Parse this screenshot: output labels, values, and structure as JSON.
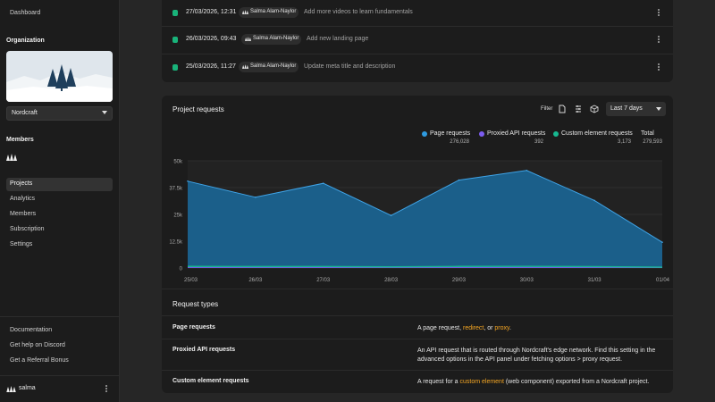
{
  "sidebar": {
    "dashboard": "Dashboard",
    "org_heading": "Organization",
    "org_name": "Nordcraft",
    "members_heading": "Members",
    "nav": [
      {
        "label": "Projects",
        "active": true
      },
      {
        "label": "Analytics",
        "active": false
      },
      {
        "label": "Members",
        "active": false
      },
      {
        "label": "Subscription",
        "active": false
      },
      {
        "label": "Settings",
        "active": false
      }
    ],
    "footer_links": [
      "Documentation",
      "Get help on Discord",
      "Get a Referral Bonus"
    ],
    "user": "salma"
  },
  "activity": [
    {
      "date": "27/03/2026, 12:31",
      "author": "Salma Alam-Naylor",
      "desc": "Add more videos to learn fundamentals"
    },
    {
      "date": "26/03/2026, 09:43",
      "author": "Salma Alam-Naylor",
      "desc": "Add new landing page"
    },
    {
      "date": "25/03/2026, 11:27",
      "author": "Salma Alam-Naylor",
      "desc": "Update meta title and description"
    }
  ],
  "requests": {
    "title": "Project requests",
    "filter_label": "Filter",
    "range": "Last 7 days",
    "legend": [
      {
        "name": "Page requests",
        "value": "276,028",
        "color": "#2f9be0"
      },
      {
        "name": "Proxied API requests",
        "value": "392",
        "color": "#7c5cf0"
      },
      {
        "name": "Custom element requests",
        "value": "3,173",
        "color": "#17b890"
      }
    ],
    "total_label": "Total",
    "total_value": "279,593"
  },
  "chart_data": {
    "type": "area",
    "x": [
      "25/03",
      "26/03",
      "27/03",
      "28/03",
      "29/03",
      "30/03",
      "31/03",
      "01/04"
    ],
    "y_ticks": [
      "50k",
      "37.5k",
      "25k",
      "12.5k",
      "0"
    ],
    "ylim": [
      0,
      50000
    ],
    "grid": true,
    "series": [
      {
        "name": "Page requests",
        "values": [
          40500,
          33000,
          39500,
          24500,
          41000,
          45500,
          31500,
          12000
        ],
        "color": "#1b5f8a"
      },
      {
        "name": "Proxied API requests",
        "values": [
          60,
          50,
          55,
          40,
          60,
          65,
          40,
          22
        ],
        "color": "#7c5cf0"
      },
      {
        "name": "Custom element requests",
        "values": [
          520,
          470,
          500,
          340,
          520,
          560,
          430,
          180
        ],
        "color": "#17b890"
      }
    ]
  },
  "request_types": {
    "title": "Request types",
    "rows": [
      {
        "name": "Page requests",
        "pre": "A page request, ",
        "link1": "redirect",
        "mid": ", or ",
        "link2": "proxy",
        "post": "."
      },
      {
        "name": "Proxied API requests",
        "text": "An API request that is routed through Nordcraft's edge network. Find this setting in the advanced options in the API panel under fetching options > proxy request."
      },
      {
        "name": "Custom element requests",
        "pre": "A request for a ",
        "link1": "custom element",
        "post": " (web component) exported from a Nordcraft project."
      }
    ]
  },
  "icons": {
    "org_logo": "trees-logo-icon",
    "export_csv": "document-icon",
    "settings": "sliders-icon",
    "embed": "cube-icon",
    "more": "kebab-icon"
  }
}
